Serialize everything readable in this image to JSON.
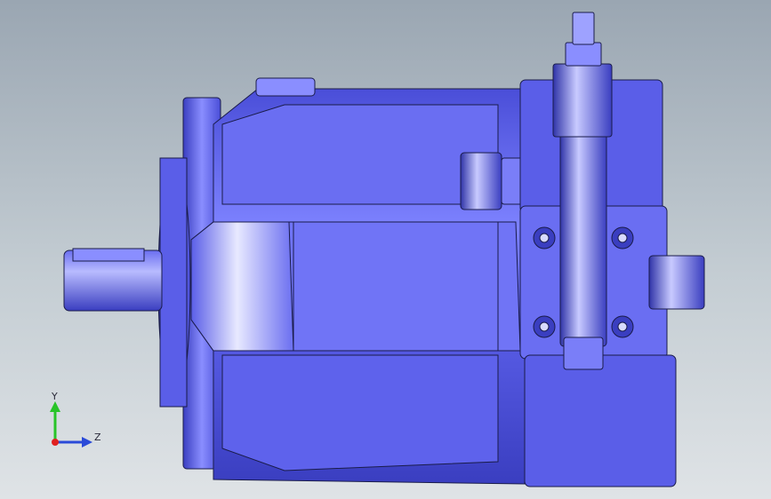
{
  "viewport": {
    "model_description": "hydraulic-pump-3d-model",
    "colors": {
      "body": "#5a5ee8",
      "body_light": "#9ea2ff",
      "body_dark": "#2a2e8a",
      "edge": "#1a1c4a",
      "background_top": "#9aa6b2",
      "background_bottom": "#dfe3e6"
    }
  },
  "triad": {
    "y_label": "Y",
    "z_label": "Z",
    "y_color": "#28c428",
    "z_color": "#2a4ad8",
    "origin_color": "#e02020"
  }
}
